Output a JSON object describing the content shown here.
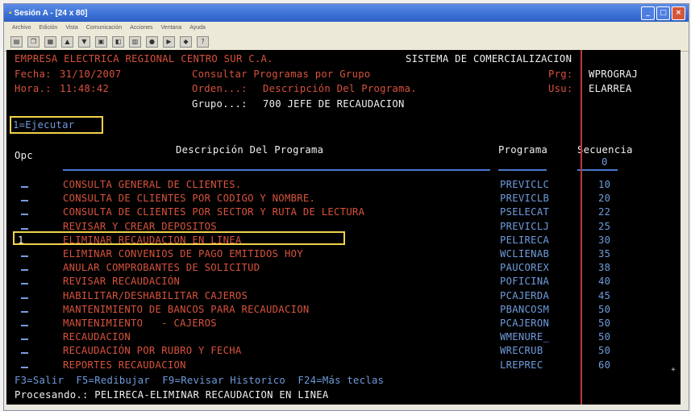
{
  "window": {
    "title": "Sesión A - [24 x 80]",
    "menu": [
      "Archivo",
      "Edición",
      "Vista",
      "Comunicación",
      "Acciones",
      "Ventana",
      "Ayuda"
    ]
  },
  "toolbar": {
    "icons": [
      "print-icon",
      "copy-icon",
      "paste-icon",
      "send-icon",
      "receive-icon",
      "display-icon",
      "color-icon",
      "map-icon",
      "record-icon",
      "play-icon",
      "macro-icon",
      "help-icon"
    ]
  },
  "header": {
    "company": "EMPRESA ELECTRICA REGIONAL CENTRO SUR C.A.",
    "system": "SISTEMA DE COMERCIALIZACION",
    "fecha_label": "Fecha:",
    "fecha_value": "31/10/2007",
    "hora_label": "Hora.:",
    "hora_value": "11:48:42",
    "screen_title": "Consultar Programas por Grupo",
    "orden_label": "Orden...:",
    "orden_value": "Descripción Del Programa.",
    "grupo_label": "Grupo...:",
    "grupo_value": "700 JEFE DE RECAUDACION",
    "prg_label": "Prg:",
    "prg_value": "WPROGRAJ",
    "usu_label": "Usu:",
    "usu_value": "ELARREA"
  },
  "options_hint": "1=Ejecutar",
  "columns": {
    "opc": "Opc",
    "descripcion": "Descripción Del Programa",
    "programa": "Programa",
    "secuencia": "Secuencia",
    "secuencia_input": "0"
  },
  "rows": [
    {
      "opc": "",
      "descripcion": "CONSULTA GENERAL DE CLIENTES.",
      "programa": "PREVICLC",
      "secuencia": "10"
    },
    {
      "opc": "",
      "descripcion": "CONSULTA DE CLIENTES POR CODIGO Y NOMBRE.",
      "programa": "PREVICLB",
      "secuencia": "20"
    },
    {
      "opc": "",
      "descripcion": "CONSULTA DE CLIENTES POR SECTOR Y RUTA DE LECTURA",
      "programa": "PSELECAT",
      "secuencia": "22"
    },
    {
      "opc": "",
      "descripcion": "REVISAR Y CREAR DEPOSITOS",
      "programa": "PREVICLJ",
      "secuencia": "25"
    },
    {
      "opc": "1",
      "descripcion": "ELIMINAR RECAUDACION EN LINEA",
      "programa": "PELIRECA",
      "secuencia": "30"
    },
    {
      "opc": "",
      "descripcion": "ELIMINAR CONVENIOS DE PAGO EMITIDOS HOY",
      "programa": "WCLIENAB",
      "secuencia": "35"
    },
    {
      "opc": "",
      "descripcion": "ANULAR COMPROBANTES DE SOLICITUD",
      "programa": "PAUCOREX",
      "secuencia": "38"
    },
    {
      "opc": "",
      "descripcion": "REVISAR RECAUDACIÓN",
      "programa": "POFICINA",
      "secuencia": "40"
    },
    {
      "opc": "",
      "descripcion": "HABILITAR/DESHABILITAR CAJEROS",
      "programa": "PCAJERDA",
      "secuencia": "45"
    },
    {
      "opc": "",
      "descripcion": "MANTENIMIENTO DE BANCOS PARA RECAUDACION",
      "programa": "PBANCOSM",
      "secuencia": "50"
    },
    {
      "opc": "",
      "descripcion": "MANTENIMIENTO   - CAJEROS",
      "programa": "PCAJERON",
      "secuencia": "50"
    },
    {
      "opc": "",
      "descripcion": "RECAUDACION",
      "programa": "WMENURE_",
      "secuencia": "50"
    },
    {
      "opc": "",
      "descripcion": "RECAUDACIÓN POR RUBRO Y FECHA",
      "programa": "WRECRUB",
      "secuencia": "50"
    },
    {
      "opc": "",
      "descripcion": "REPORTES RECAUDACION",
      "programa": "LREPREC",
      "secuencia": "60"
    }
  ],
  "more_indicator": "+",
  "function_keys": "F3=Salir  F5=Redibujar  F9=Revisar Historico  F24=Más teclas",
  "status": "Procesando.: PELIRECA-ELIMINAR RECAUDACION EN LINEA",
  "colors": {
    "terminal_bg": "#000000",
    "red": "#d8523c",
    "blue": "#6f9bdc",
    "cyan": "#6fd0e8",
    "white": "#f0f0f0",
    "highlight": "#f0d24a"
  }
}
